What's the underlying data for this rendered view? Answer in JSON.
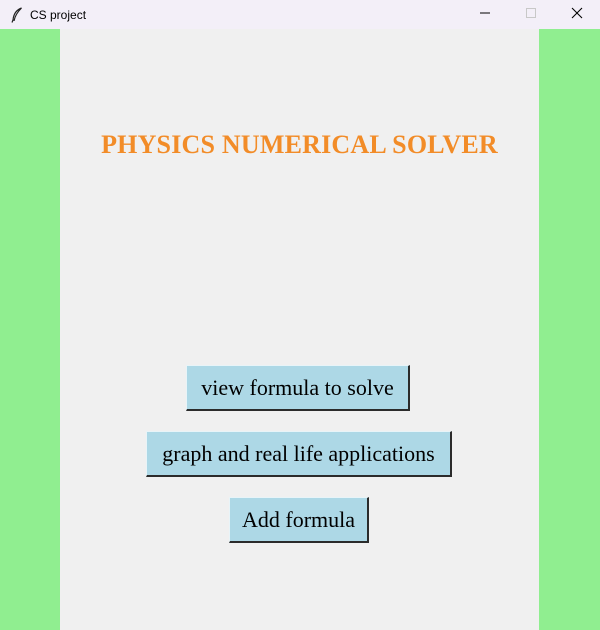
{
  "window": {
    "title": "CS project",
    "icon": "feather-icon",
    "controls": {
      "minimize_icon": "minimize-icon",
      "maximize_icon": "maximize-icon",
      "close_icon": "close-icon"
    }
  },
  "main": {
    "heading": "PHYSICS NUMERICAL SOLVER",
    "buttons": [
      {
        "label": "view formula to solve"
      },
      {
        "label": "graph and real life applications"
      },
      {
        "label": "Add formula"
      }
    ]
  },
  "colors": {
    "side_background": "#90ee90",
    "content_background": "#f0f0f0",
    "heading": "#f28c28",
    "button_background": "#add8e6",
    "titlebar": "#f3eff8"
  }
}
